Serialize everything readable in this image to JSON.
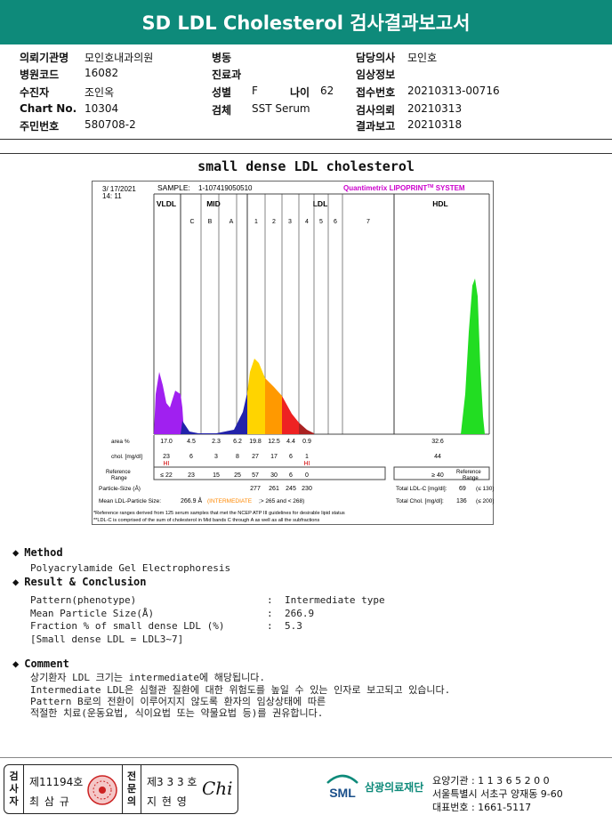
{
  "header": {
    "title": "SD LDL Cholesterol 검사결과보고서"
  },
  "info": {
    "rows": [
      [
        {
          "label": "의뢰기관명",
          "value": "모인호내과의원"
        },
        {
          "label": "병동",
          "value": ""
        },
        {
          "label": "담당의사",
          "value": "모인호"
        }
      ],
      [
        {
          "label": "병원코드",
          "value": "16082"
        },
        {
          "label": "진료과",
          "value": ""
        },
        {
          "label": "임상정보",
          "value": ""
        }
      ],
      [
        {
          "label": "수진자",
          "value": "조인옥"
        },
        {
          "label": "성별",
          "value": "F"
        },
        {
          "label": "접수번호",
          "value": "20210313-00716"
        }
      ],
      [
        {
          "label": "Chart No.",
          "value": "10304"
        },
        {
          "label": "검체",
          "value": "SST Serum"
        },
        {
          "label": "검사의뢰",
          "value": "20210313"
        }
      ],
      [
        {
          "label": "주민번호",
          "value": "580708-2"
        },
        {
          "label": "",
          "value": ""
        },
        {
          "label": "결과보고",
          "value": "20210318"
        }
      ]
    ],
    "age_label": "나이",
    "age_value": "62"
  },
  "section_title": "small dense LDL cholesterol",
  "chart_data": {
    "type": "area",
    "header_date": "3/ 17/2021",
    "header_time": "14: 11",
    "sample_label": "SAMPLE:",
    "sample_id": "1-107419050510",
    "system_name": "Quantimetrix LIPOPRINT",
    "system_sup": "TM",
    "system_suffix": " SYSTEM",
    "groups": [
      "VLDL",
      "MID",
      "LDL",
      "HDL"
    ],
    "subfractions": [
      "C",
      "B",
      "A",
      "1",
      "2",
      "3",
      "4",
      "5",
      "6",
      "7"
    ],
    "row_labels": {
      "area": "area %",
      "chol": "chol. [mg/dl]",
      "ref": "Reference Range",
      "ps": "Particle-Size (Å)",
      "mean": "Mean LDL-Particle Size:"
    },
    "area_pct": [
      "17.0",
      "4.5",
      "2.3",
      "6.2",
      "19.8",
      "12.5",
      "4.4",
      "0.9",
      "32.6"
    ],
    "chol": [
      "23",
      "6",
      "3",
      "8",
      "27",
      "17",
      "6",
      "1",
      "44"
    ],
    "hi_flags": [
      "HI",
      "HI"
    ],
    "ref_range": [
      "≤ 22",
      "23",
      "15",
      "25",
      "57",
      "30",
      "6",
      "0",
      "≥ 40"
    ],
    "ref_range_label": "Reference Range",
    "particle_size": [
      "277",
      "261",
      "245",
      "230"
    ],
    "mean_value": "266.9 Å",
    "mean_type": "(INTERMEDIATE",
    "mean_range": ";> 265 and < 268)",
    "total_ldl_label": "Total LDL-C [mg/dl]:",
    "total_ldl_value": "69",
    "total_ldl_ref": "(≤ 130)",
    "total_chol_label": "Total Chol. [mg/dl]:",
    "total_chol_value": "136",
    "total_chol_ref": "(≤ 200)",
    "footnotes": [
      "*Reference ranges derived from 125 serum samples that met the NCEP ATP III guidelines for desirable lipid status",
      "**LDL-C is comprised of the sum of cholesterol in Mid bands C through A as well as all the subfractions"
    ],
    "colors": {
      "vldl": "#a020f0",
      "mid": "#2222aa",
      "ldl1": "#ffd400",
      "ldl2": "#ff9900",
      "ldl3": "#ee2222",
      "ldl4": "#aa2222",
      "hdl": "#22dd22",
      "system": "#cc00cc",
      "hi": "#d00000",
      "intermediate": "#ff8800"
    }
  },
  "method": {
    "title": "Method",
    "text": "Polyacrylamide Gel Electrophoresis"
  },
  "result": {
    "title": "Result & Conclusion",
    "rows": [
      {
        "label": "Pattern(phenotype)",
        "value": "Intermediate type"
      },
      {
        "label": "Mean Particle Size(Å)",
        "value": "266.9"
      },
      {
        "label": "Fraction % of small dense LDL (%)",
        "value": "5.3"
      }
    ],
    "note": "[Small dense LDL = LDL3~7]",
    "colon": ":"
  },
  "comment": {
    "title": "Comment",
    "lines": [
      "상기환자 LDL 크기는 intermediate에 해당됩니다.",
      "Intermediate LDL은 심혈관 질환에 대한 위험도를 높일 수 있는 인자로 보고되고 있습니다.",
      "Pattern B로의 전환이 이루어지지 않도록 환자의 임상상태에 따른",
      "적절한 치료(운동요법, 식이요법 또는 약물요법 등)를 권유합니다."
    ]
  },
  "footer": {
    "role1": [
      "검",
      "사",
      "자"
    ],
    "license1": "제11194호",
    "name1": "최 삼 규",
    "role2": [
      "전",
      "문",
      "의"
    ],
    "license2": "제3 3 3 호",
    "name2": "지 현 영",
    "signature": "Chi",
    "logo_mark": "SML",
    "logo_text": "삼광의료재단",
    "contact": [
      "요양기관 : 1 1 3 6 5 2 0 0",
      "서울특별시 서초구 양재동 9-60",
      "대표번호 : 1661-5117"
    ]
  }
}
